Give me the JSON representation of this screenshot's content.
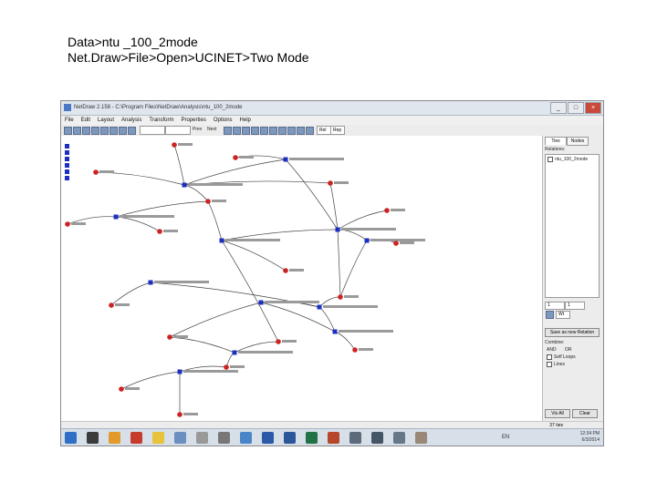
{
  "caption": {
    "line1": "Data>ntu _100_2mode",
    "line2": "Net.Draw>File>Open>UCINET>Two Mode"
  },
  "window": {
    "title": "NetDraw 2.158 - C:\\Program Files\\NetDraw\\Analysis\\ntu_100_2mode",
    "controls": [
      "_",
      "□",
      "×"
    ]
  },
  "menu": [
    "File",
    "Edit",
    "Layout",
    "Analysis",
    "Transform",
    "Properties",
    "Options",
    "Help"
  ],
  "toolbar": {
    "combo1": "",
    "combo2": "",
    "label_a": "Prev",
    "label_b": "Next",
    "field_prev": "Rel",
    "field_next": "Rep"
  },
  "panel": {
    "tabs": [
      "Ties",
      "Nodes"
    ],
    "label_relations": "Relations:",
    "relation_item": "ntu_100_2mode",
    "value_field1": "1",
    "value_field2": "1",
    "button_set": "Save as new Relation",
    "label_combine": "Combine:",
    "option_and": "AND",
    "option_or": "OR",
    "check_self": "Self Loops",
    "check_lines": "Lines",
    "label_weight": "Wt",
    "button_a": "Vis All",
    "button_b": "Clear"
  },
  "status": {
    "text": "37 ties"
  },
  "taskbar": {
    "lang": "EN",
    "time": "12:34 PM",
    "date": "6/3/2014"
  },
  "colors": {
    "edge": "#444444",
    "actor_node": "#cc2222",
    "event_node": "#1b2fc4",
    "label": "#222222"
  },
  "icons": [
    "windows-start-icon",
    "file-explorer-icon",
    "media-icon",
    "filezilla-icon",
    "chrome-icon",
    "app-icon",
    "app-icon",
    "app-icon",
    "app-icon",
    "netdraw-icon",
    "word-icon",
    "excel-icon",
    "powerpoint-icon",
    "app-icon",
    "app-icon",
    "app-icon",
    "app-icon"
  ]
}
